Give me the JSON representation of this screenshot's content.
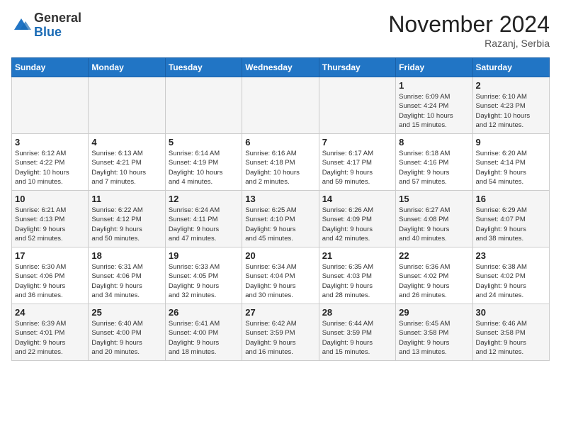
{
  "logo": {
    "general": "General",
    "blue": "Blue"
  },
  "header": {
    "month": "November 2024",
    "location": "Razanj, Serbia"
  },
  "weekdays": [
    "Sunday",
    "Monday",
    "Tuesday",
    "Wednesday",
    "Thursday",
    "Friday",
    "Saturday"
  ],
  "weeks": [
    [
      {
        "day": "",
        "info": ""
      },
      {
        "day": "",
        "info": ""
      },
      {
        "day": "",
        "info": ""
      },
      {
        "day": "",
        "info": ""
      },
      {
        "day": "",
        "info": ""
      },
      {
        "day": "1",
        "info": "Sunrise: 6:09 AM\nSunset: 4:24 PM\nDaylight: 10 hours\nand 15 minutes."
      },
      {
        "day": "2",
        "info": "Sunrise: 6:10 AM\nSunset: 4:23 PM\nDaylight: 10 hours\nand 12 minutes."
      }
    ],
    [
      {
        "day": "3",
        "info": "Sunrise: 6:12 AM\nSunset: 4:22 PM\nDaylight: 10 hours\nand 10 minutes."
      },
      {
        "day": "4",
        "info": "Sunrise: 6:13 AM\nSunset: 4:21 PM\nDaylight: 10 hours\nand 7 minutes."
      },
      {
        "day": "5",
        "info": "Sunrise: 6:14 AM\nSunset: 4:19 PM\nDaylight: 10 hours\nand 4 minutes."
      },
      {
        "day": "6",
        "info": "Sunrise: 6:16 AM\nSunset: 4:18 PM\nDaylight: 10 hours\nand 2 minutes."
      },
      {
        "day": "7",
        "info": "Sunrise: 6:17 AM\nSunset: 4:17 PM\nDaylight: 9 hours\nand 59 minutes."
      },
      {
        "day": "8",
        "info": "Sunrise: 6:18 AM\nSunset: 4:16 PM\nDaylight: 9 hours\nand 57 minutes."
      },
      {
        "day": "9",
        "info": "Sunrise: 6:20 AM\nSunset: 4:14 PM\nDaylight: 9 hours\nand 54 minutes."
      }
    ],
    [
      {
        "day": "10",
        "info": "Sunrise: 6:21 AM\nSunset: 4:13 PM\nDaylight: 9 hours\nand 52 minutes."
      },
      {
        "day": "11",
        "info": "Sunrise: 6:22 AM\nSunset: 4:12 PM\nDaylight: 9 hours\nand 50 minutes."
      },
      {
        "day": "12",
        "info": "Sunrise: 6:24 AM\nSunset: 4:11 PM\nDaylight: 9 hours\nand 47 minutes."
      },
      {
        "day": "13",
        "info": "Sunrise: 6:25 AM\nSunset: 4:10 PM\nDaylight: 9 hours\nand 45 minutes."
      },
      {
        "day": "14",
        "info": "Sunrise: 6:26 AM\nSunset: 4:09 PM\nDaylight: 9 hours\nand 42 minutes."
      },
      {
        "day": "15",
        "info": "Sunrise: 6:27 AM\nSunset: 4:08 PM\nDaylight: 9 hours\nand 40 minutes."
      },
      {
        "day": "16",
        "info": "Sunrise: 6:29 AM\nSunset: 4:07 PM\nDaylight: 9 hours\nand 38 minutes."
      }
    ],
    [
      {
        "day": "17",
        "info": "Sunrise: 6:30 AM\nSunset: 4:06 PM\nDaylight: 9 hours\nand 36 minutes."
      },
      {
        "day": "18",
        "info": "Sunrise: 6:31 AM\nSunset: 4:06 PM\nDaylight: 9 hours\nand 34 minutes."
      },
      {
        "day": "19",
        "info": "Sunrise: 6:33 AM\nSunset: 4:05 PM\nDaylight: 9 hours\nand 32 minutes."
      },
      {
        "day": "20",
        "info": "Sunrise: 6:34 AM\nSunset: 4:04 PM\nDaylight: 9 hours\nand 30 minutes."
      },
      {
        "day": "21",
        "info": "Sunrise: 6:35 AM\nSunset: 4:03 PM\nDaylight: 9 hours\nand 28 minutes."
      },
      {
        "day": "22",
        "info": "Sunrise: 6:36 AM\nSunset: 4:02 PM\nDaylight: 9 hours\nand 26 minutes."
      },
      {
        "day": "23",
        "info": "Sunrise: 6:38 AM\nSunset: 4:02 PM\nDaylight: 9 hours\nand 24 minutes."
      }
    ],
    [
      {
        "day": "24",
        "info": "Sunrise: 6:39 AM\nSunset: 4:01 PM\nDaylight: 9 hours\nand 22 minutes."
      },
      {
        "day": "25",
        "info": "Sunrise: 6:40 AM\nSunset: 4:00 PM\nDaylight: 9 hours\nand 20 minutes."
      },
      {
        "day": "26",
        "info": "Sunrise: 6:41 AM\nSunset: 4:00 PM\nDaylight: 9 hours\nand 18 minutes."
      },
      {
        "day": "27",
        "info": "Sunrise: 6:42 AM\nSunset: 3:59 PM\nDaylight: 9 hours\nand 16 minutes."
      },
      {
        "day": "28",
        "info": "Sunrise: 6:44 AM\nSunset: 3:59 PM\nDaylight: 9 hours\nand 15 minutes."
      },
      {
        "day": "29",
        "info": "Sunrise: 6:45 AM\nSunset: 3:58 PM\nDaylight: 9 hours\nand 13 minutes."
      },
      {
        "day": "30",
        "info": "Sunrise: 6:46 AM\nSunset: 3:58 PM\nDaylight: 9 hours\nand 12 minutes."
      }
    ]
  ]
}
